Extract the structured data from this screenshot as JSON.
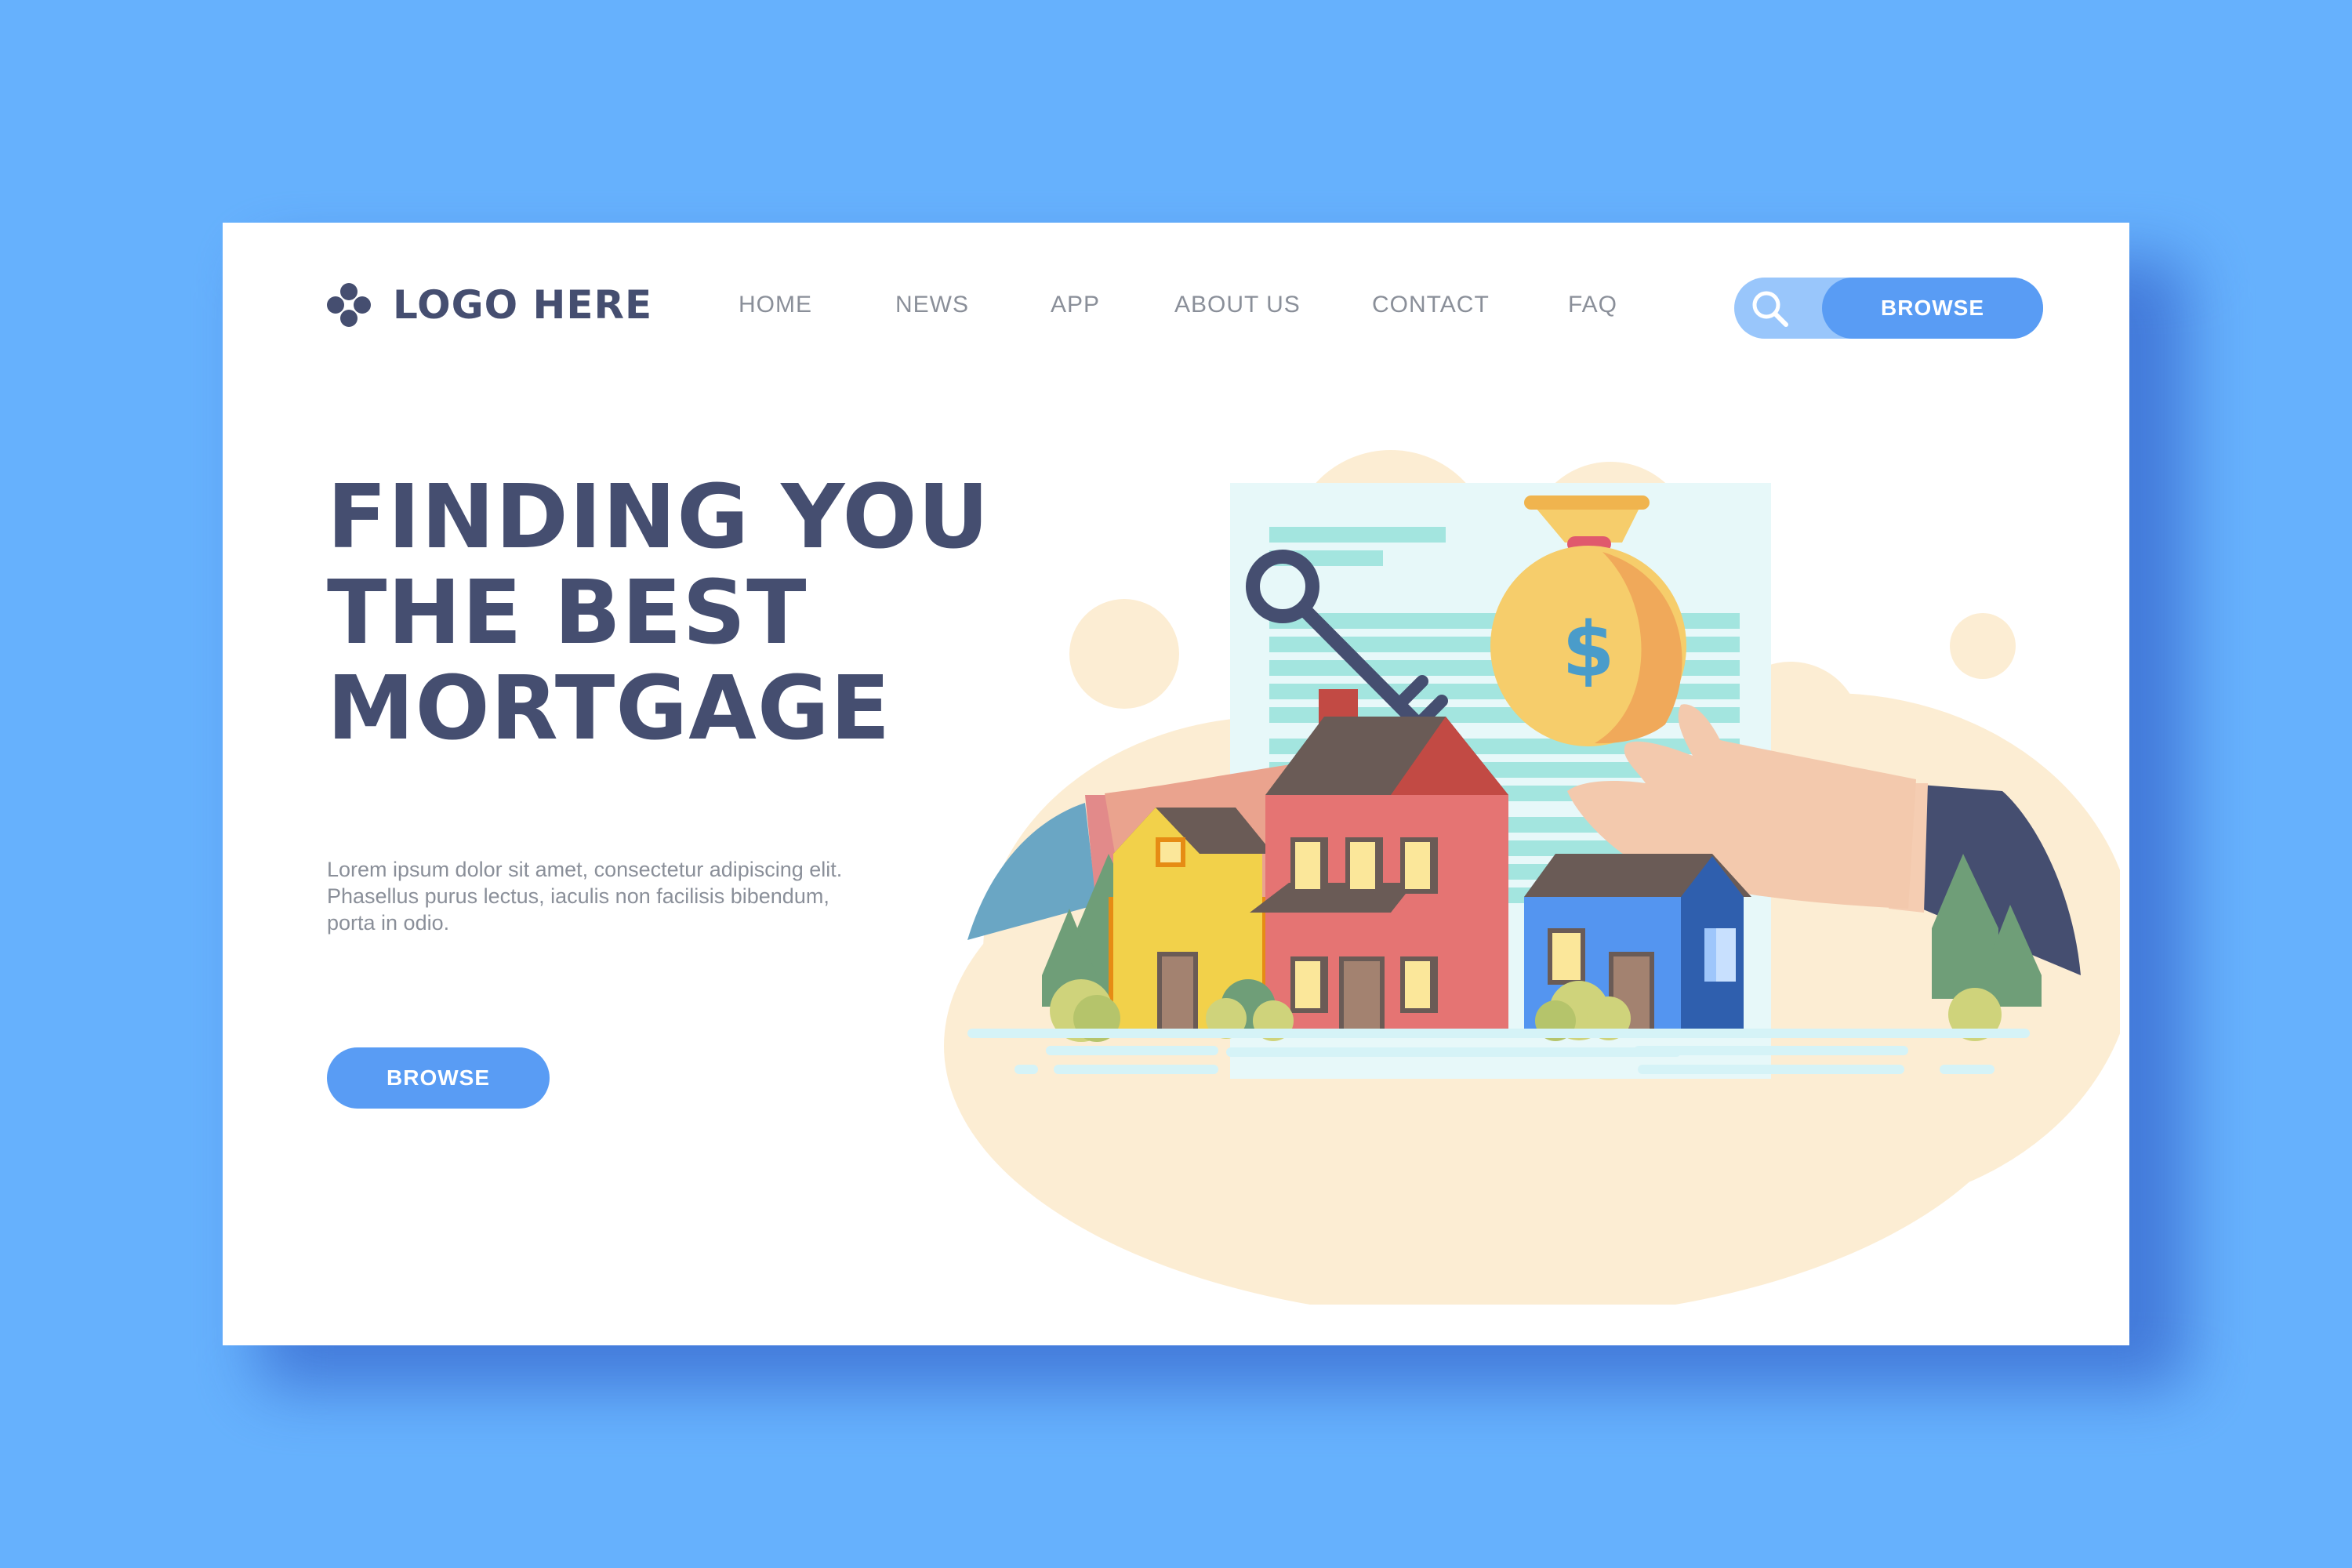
{
  "header": {
    "logo_text": "LOGO HERE",
    "logo_icon": "four-dot-logo-icon"
  },
  "nav": {
    "items": [
      {
        "label": "HOME"
      },
      {
        "label": "NEWS"
      },
      {
        "label": "APP"
      },
      {
        "label": "ABOUT US"
      },
      {
        "label": "CONTACT"
      },
      {
        "label": "FAQ"
      }
    ]
  },
  "search": {
    "icon": "search-icon",
    "button_label": "BROWSE"
  },
  "hero": {
    "headline_lines": [
      "FINDING YOU",
      "THE BEST",
      "MORTGAGE"
    ],
    "body_lines": [
      "Lorem ipsum dolor sit amet, consectetur adipiscing elit.",
      "Phasellus purus lectus, iaculis non facilisis bibendum,",
      "porta in odio."
    ],
    "cta_label": "BROWSE"
  },
  "illustration": {
    "money_symbol": "$",
    "icons": [
      "key-icon",
      "money-bag-icon",
      "document-icon",
      "houses-icon",
      "hands-icon"
    ]
  },
  "colors": {
    "background": "#66b1fd",
    "card": "#ffffff",
    "text_dark": "#454e70",
    "text_muted": "#8a8f99",
    "accent_blue": "#599cf4",
    "accent_light": "#99c6fb"
  }
}
